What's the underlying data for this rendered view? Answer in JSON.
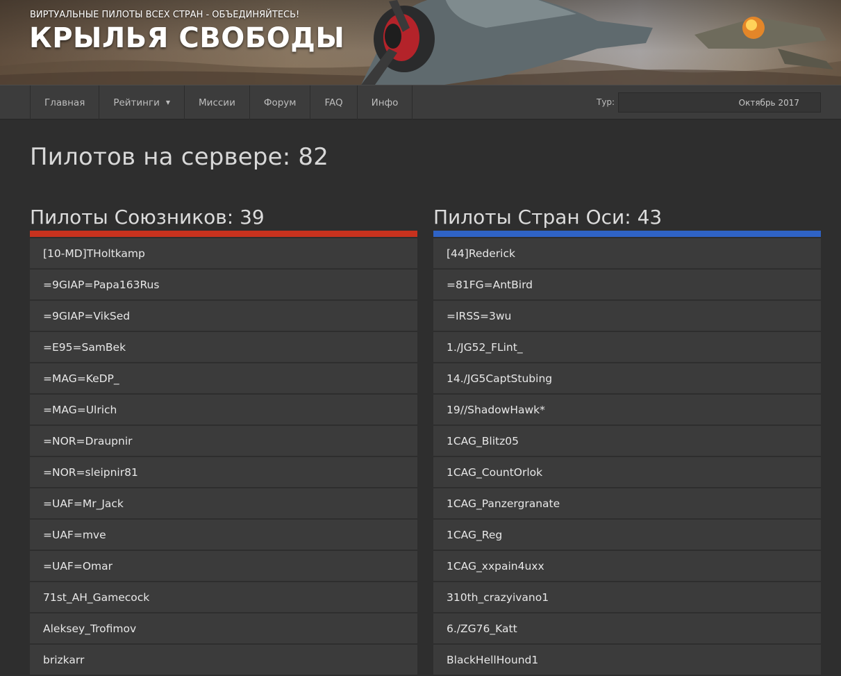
{
  "header": {
    "tagline": "ВИРТУАЛЬНЫЕ ПИЛОТЫ ВСЕХ СТРАН - ОБЪЕДИНЯЙТЕСЬ!",
    "title": "КРЫЛЬЯ СВОБОДЫ"
  },
  "nav": {
    "items": [
      {
        "label": "Главная"
      },
      {
        "label": "Рейтинги",
        "dropdown": true
      },
      {
        "label": "Миссии"
      },
      {
        "label": "Форум"
      },
      {
        "label": "FAQ"
      },
      {
        "label": "Инфо"
      }
    ],
    "tour_label": "Тур:",
    "tour_value": "Октябрь 2017"
  },
  "main": {
    "heading": "Пилотов на сервере: 82",
    "allies": {
      "title": "Пилоты Союзников: 39",
      "color": "#c8321e",
      "pilots": [
        "[10-MD]THoltkamp",
        "=9GIAP=Papa163Rus",
        "=9GIAP=VikSed",
        "=E95=SamBek",
        "=MAG=KeDP_",
        "=MAG=Ulrich",
        "=NOR=Draupnir",
        "=NOR=sleipnir81",
        "=UAF=Mr_Jack",
        "=UAF=mve",
        "=UAF=Omar",
        "71st_AH_Gamecock",
        "Aleksey_Trofimov",
        "brizkarr"
      ]
    },
    "axis": {
      "title": "Пилоты Стран Оси: 43",
      "color": "#2f63c6",
      "pilots": [
        "[44]Rederick",
        "=81FG=AntBird",
        "=IRSS=3wu",
        "1./JG52_FLint_",
        "14./JG5CaptStubing",
        "19//ShadowHawk*",
        "1CAG_Blitz05",
        "1CAG_CountOrlok",
        "1CAG_Panzergranate",
        "1CAG_Reg",
        "1CAG_xxpain4uxx",
        "310th_crazyivano1",
        "6./ZG76_Katt",
        "BlackHellHound1"
      ]
    }
  }
}
